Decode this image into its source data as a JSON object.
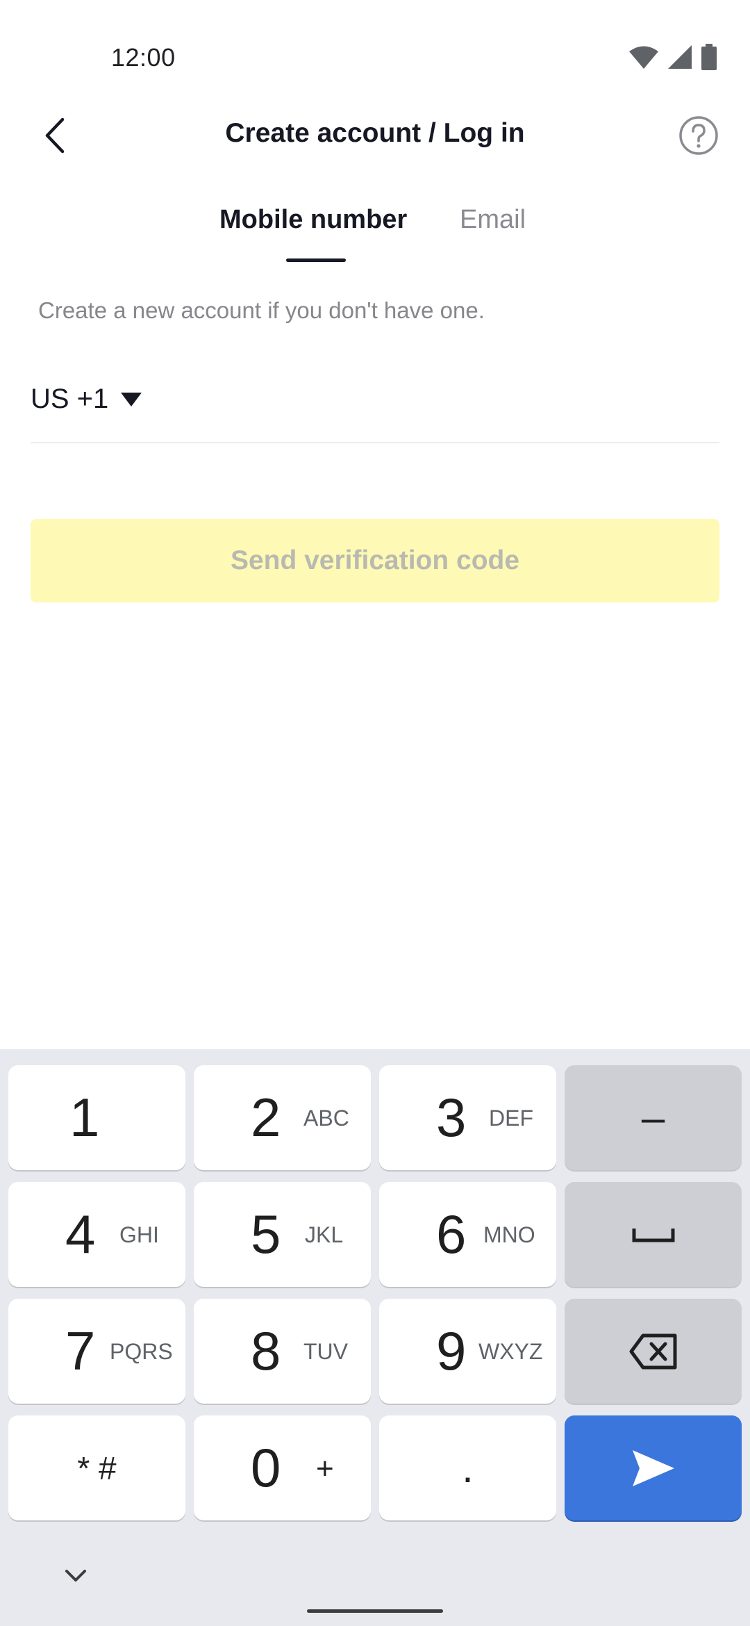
{
  "status_bar": {
    "time": "12:00"
  },
  "header": {
    "title": "Create account / Log in"
  },
  "tabs": [
    {
      "label": "Mobile number",
      "selected": true
    },
    {
      "label": "Email",
      "selected": false
    }
  ],
  "hint": "Create a new account if you don't have one.",
  "phone": {
    "country_code": "US +1",
    "value": ""
  },
  "send_button": {
    "label": "Send verification code",
    "enabled": false
  },
  "keyboard": {
    "keys": [
      {
        "digit": "1",
        "letters": ""
      },
      {
        "digit": "2",
        "letters": "ABC"
      },
      {
        "digit": "3",
        "letters": "DEF"
      },
      {
        "digit": "4",
        "letters": "GHI"
      },
      {
        "digit": "5",
        "letters": "JKL"
      },
      {
        "digit": "6",
        "letters": "MNO"
      },
      {
        "digit": "7",
        "letters": "PQRS"
      },
      {
        "digit": "8",
        "letters": "TUV"
      },
      {
        "digit": "9",
        "letters": "WXYZ"
      },
      {
        "digit": "0",
        "letters": "+"
      }
    ],
    "star_hash": "* #",
    "dash": "–",
    "period": "."
  },
  "colors": {
    "accent_blue": "#3b76dd",
    "disabled_yellow": "#fefab5",
    "keyboard_bg": "#e8e9ee"
  }
}
